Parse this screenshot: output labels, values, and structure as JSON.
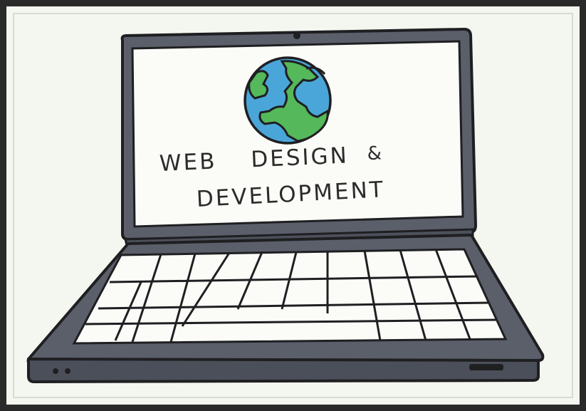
{
  "screen": {
    "line1": {
      "word1": "WEB",
      "word2": "DESIGN",
      "amp": "&"
    },
    "line2": "DEVELOPMENT"
  },
  "icons": {
    "globe": "globe-icon",
    "webcam": "webcam-icon",
    "indicator_lights": "indicator-lights-icon",
    "port": "port-icon"
  },
  "colors": {
    "laptop_body": "#5a5f6a",
    "laptop_outline": "#1f1f22",
    "screen": "#fbfcf8",
    "globe_ocean": "#4aa6d8",
    "globe_land": "#55b85a",
    "paper": "#f4f6f0"
  }
}
